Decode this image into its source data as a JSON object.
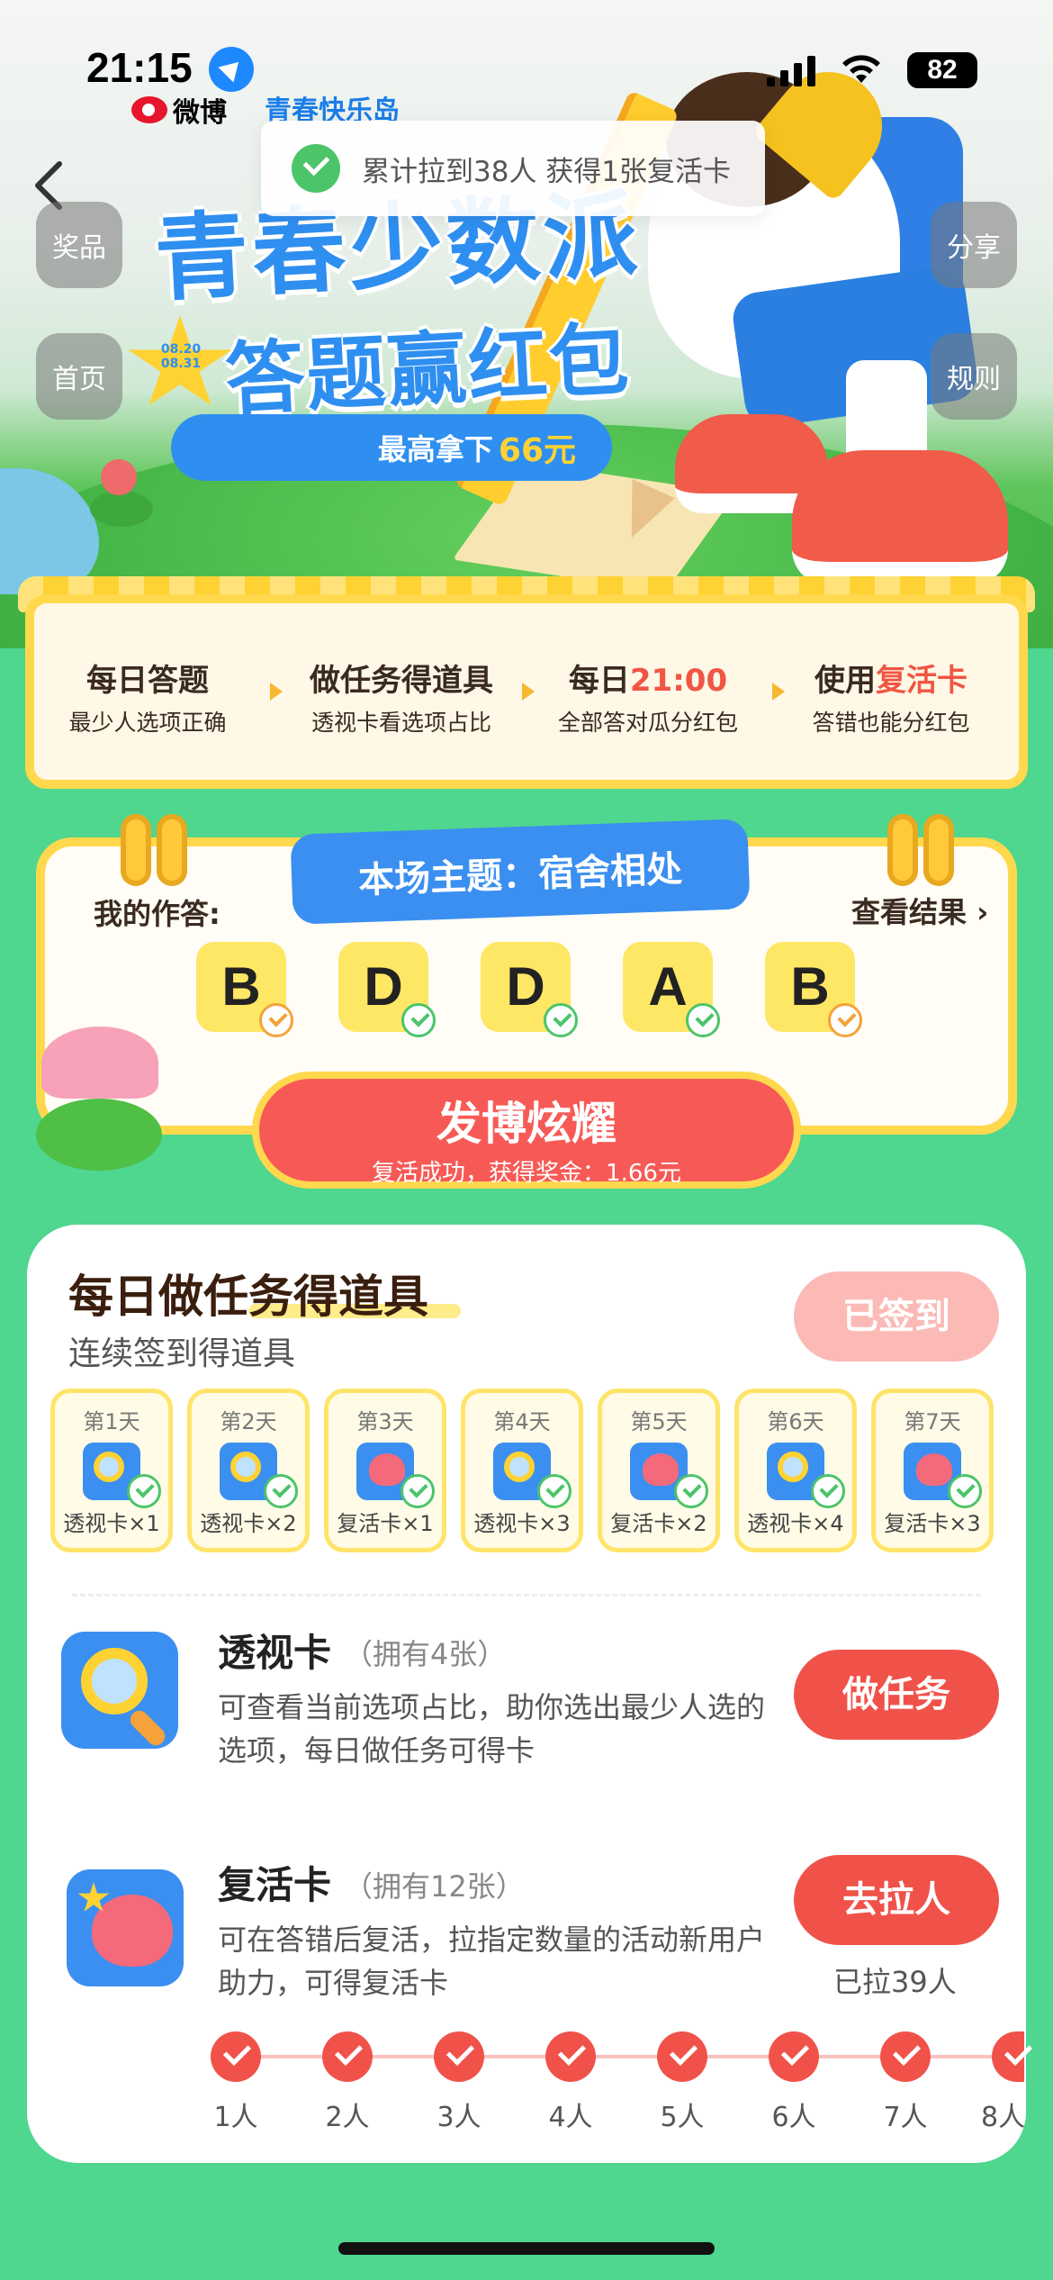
{
  "status_bar": {
    "time": "21:15",
    "battery": "82"
  },
  "header": {
    "app_name": "微博",
    "brand": "青春快乐岛"
  },
  "toast": {
    "text": "累计拉到38人 获得1张复活卡"
  },
  "side_buttons": {
    "prizes": "奖品",
    "home": "首页",
    "share": "分享",
    "rules": "规则"
  },
  "hero": {
    "title": "青春少数派",
    "subtitle": "答题赢红包",
    "prize_prefix": "最高拿下",
    "prize_amount": "66元",
    "date_line1": "08.20",
    "date_line2": "08.31"
  },
  "rules": [
    {
      "title": "每日答题",
      "desc_hl": "最少人",
      "desc": "选项正确"
    },
    {
      "title": "做任务得道具",
      "desc_hl": "透视卡",
      "desc": "看选项占比"
    },
    {
      "title_prefix": "每日",
      "title_hl": "21:00",
      "desc": "全部答对瓜分红包"
    },
    {
      "title_prefix": "使用",
      "title_hl": "复活卡",
      "desc": "答错也能分红包"
    }
  ],
  "answers_card": {
    "topic": "本场主题：宿舍相处",
    "my_answers_label": "我的作答:",
    "view_results": "查看结果 ›",
    "answers": [
      "B",
      "D",
      "D",
      "A",
      "B"
    ],
    "share_title": "发博炫耀",
    "share_sub": "复活成功，获得奖金：1.66元"
  },
  "tasks": {
    "title": "每日做任务得道具",
    "subtitle": "连续签到得道具",
    "checked_in": "已签到",
    "days": [
      {
        "day": "第1天",
        "reward": "透视卡×1",
        "icon": "magnifier-icon"
      },
      {
        "day": "第2天",
        "reward": "透视卡×2",
        "icon": "magnifier-icon"
      },
      {
        "day": "第3天",
        "reward": "复活卡×1",
        "icon": "heart-icon"
      },
      {
        "day": "第4天",
        "reward": "透视卡×3",
        "icon": "magnifier-icon"
      },
      {
        "day": "第5天",
        "reward": "复活卡×2",
        "icon": "heart-icon"
      },
      {
        "day": "第6天",
        "reward": "透视卡×4",
        "icon": "magnifier-icon"
      },
      {
        "day": "第7天",
        "reward": "复活卡×3",
        "icon": "heart-icon"
      }
    ],
    "items": [
      {
        "name": "透视卡",
        "owned": "（拥有4张）",
        "desc": "可查看当前选项占比，助你选出最少人选的选项，每日做任务可得卡",
        "button": "做任务"
      },
      {
        "name": "复活卡",
        "owned": "（拥有12张）",
        "desc": "可在答错后复活，拉指定数量的活动新用户助力，可得复活卡",
        "button": "去拉人",
        "invited": "已拉39人"
      }
    ],
    "progress_steps": [
      "1人",
      "2人",
      "3人",
      "4人",
      "5人",
      "6人",
      "7人",
      "8人"
    ]
  },
  "colors": {
    "accent_red": "#f0524a",
    "accent_blue": "#3b8ff0",
    "accent_yellow": "#ffd84d",
    "page_green": "#4fd68f"
  }
}
